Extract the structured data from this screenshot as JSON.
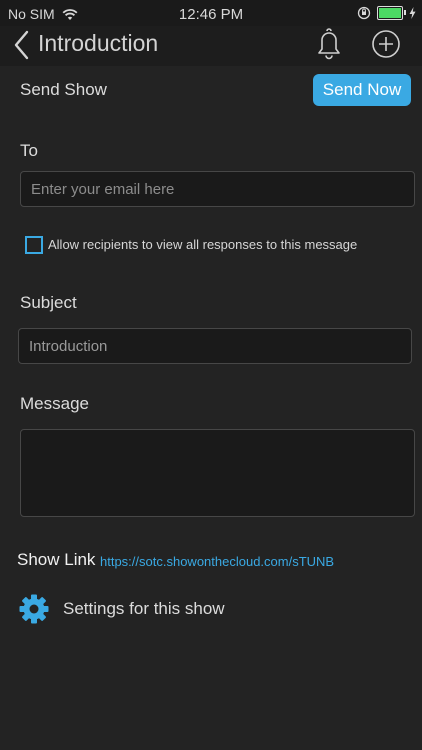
{
  "status_bar": {
    "carrier": "No SIM",
    "time": "12:46 PM"
  },
  "nav": {
    "title": "Introduction",
    "back_icon": "chevron-left-icon",
    "bell_icon": "bell-icon",
    "add_icon": "plus-circle-icon"
  },
  "send_show": {
    "label": "Send Show",
    "button": "Send Now"
  },
  "to": {
    "label": "To",
    "placeholder": "Enter your email here"
  },
  "allow_responses": {
    "label": "Allow recipients to view all responses to this message",
    "checked": false
  },
  "subject": {
    "label": "Subject",
    "value": "Introduction"
  },
  "message": {
    "label": "Message",
    "value": ""
  },
  "show_link": {
    "label": "Show Link",
    "url": "https://sotc.showonthecloud.com/sTUNB"
  },
  "settings": {
    "label": "Settings for this show",
    "icon": "gear-icon"
  },
  "colors": {
    "accent": "#3aa9e3",
    "background": "#232323",
    "battery": "#4cd964"
  }
}
